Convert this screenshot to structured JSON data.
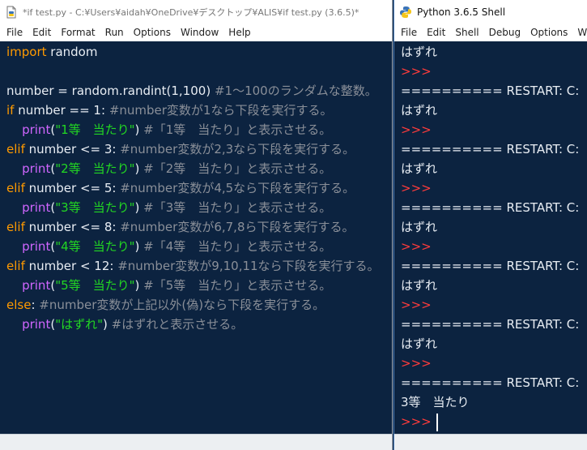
{
  "editor": {
    "title": "*if test.py - C:¥Users¥aidah¥OneDrive¥デスクトップ¥ALIS¥if test.py (3.6.5)*",
    "menu": [
      "File",
      "Edit",
      "Format",
      "Run",
      "Options",
      "Window",
      "Help"
    ],
    "code": [
      [
        {
          "t": "kw",
          "v": "import"
        },
        {
          "t": "tx",
          "v": " random"
        }
      ],
      [],
      [
        {
          "t": "tx",
          "v": "number = random.randint(1,100) "
        },
        {
          "t": "cm",
          "v": "#1～100のランダムな整数。"
        }
      ],
      [
        {
          "t": "kw",
          "v": "if"
        },
        {
          "t": "tx",
          "v": " number == 1: "
        },
        {
          "t": "cm",
          "v": "#number変数が1なら下段を実行する。"
        }
      ],
      [
        {
          "t": "tx",
          "v": "    "
        },
        {
          "t": "bi",
          "v": "print"
        },
        {
          "t": "tx",
          "v": "("
        },
        {
          "t": "st",
          "v": "\"1等　当たり\""
        },
        {
          "t": "tx",
          "v": ") "
        },
        {
          "t": "cm",
          "v": "#「1等　当たり」と表示させる。"
        }
      ],
      [
        {
          "t": "kw",
          "v": "elif"
        },
        {
          "t": "tx",
          "v": " number <= 3: "
        },
        {
          "t": "cm",
          "v": "#number変数が2,3なら下段を実行する。"
        }
      ],
      [
        {
          "t": "tx",
          "v": "    "
        },
        {
          "t": "bi",
          "v": "print"
        },
        {
          "t": "tx",
          "v": "("
        },
        {
          "t": "st",
          "v": "\"2等　当たり\""
        },
        {
          "t": "tx",
          "v": ") "
        },
        {
          "t": "cm",
          "v": "#「2等　当たり」と表示させる。"
        }
      ],
      [
        {
          "t": "kw",
          "v": "elif"
        },
        {
          "t": "tx",
          "v": " number <= 5: "
        },
        {
          "t": "cm",
          "v": "#number変数が4,5なら下段を実行する。"
        }
      ],
      [
        {
          "t": "tx",
          "v": "    "
        },
        {
          "t": "bi",
          "v": "print"
        },
        {
          "t": "tx",
          "v": "("
        },
        {
          "t": "st",
          "v": "\"3等　当たり\""
        },
        {
          "t": "tx",
          "v": ") "
        },
        {
          "t": "cm",
          "v": "#「3等　当たり」と表示させる。"
        }
      ],
      [
        {
          "t": "kw",
          "v": "elif"
        },
        {
          "t": "tx",
          "v": " number <= 8: "
        },
        {
          "t": "cm",
          "v": "#number変数が6,7,8ら下段を実行する。"
        }
      ],
      [
        {
          "t": "tx",
          "v": "    "
        },
        {
          "t": "bi",
          "v": "print"
        },
        {
          "t": "tx",
          "v": "("
        },
        {
          "t": "st",
          "v": "\"4等　当たり\""
        },
        {
          "t": "tx",
          "v": ") "
        },
        {
          "t": "cm",
          "v": "#「4等　当たり」と表示させる。"
        }
      ],
      [
        {
          "t": "kw",
          "v": "elif"
        },
        {
          "t": "tx",
          "v": " number < 12: "
        },
        {
          "t": "cm",
          "v": "#number変数が9,10,11なら下段を実行する。"
        }
      ],
      [
        {
          "t": "tx",
          "v": "    "
        },
        {
          "t": "bi",
          "v": "print"
        },
        {
          "t": "tx",
          "v": "("
        },
        {
          "t": "st",
          "v": "\"5等　当たり\""
        },
        {
          "t": "tx",
          "v": ") "
        },
        {
          "t": "cm",
          "v": "#「5等　当たり」と表示させる。"
        }
      ],
      [
        {
          "t": "kw",
          "v": "else"
        },
        {
          "t": "tx",
          "v": ": "
        },
        {
          "t": "cm",
          "v": "#number変数が上記以外(偽)なら下段を実行する。"
        }
      ],
      [
        {
          "t": "tx",
          "v": "    "
        },
        {
          "t": "bi",
          "v": "print"
        },
        {
          "t": "tx",
          "v": "("
        },
        {
          "t": "st",
          "v": "\"はずれ\""
        },
        {
          "t": "tx",
          "v": ") "
        },
        {
          "t": "cm",
          "v": "#はずれと表示させる。"
        }
      ]
    ]
  },
  "shell": {
    "title": "Python 3.6.5 Shell",
    "menu": [
      "File",
      "Edit",
      "Shell",
      "Debug",
      "Options",
      "Window"
    ],
    "lines": [
      {
        "t": "out",
        "v": "はずれ"
      },
      {
        "t": "pr",
        "v": ">>>"
      },
      {
        "t": "out",
        "v": "========== RESTART: C:"
      },
      {
        "t": "out",
        "v": "はずれ"
      },
      {
        "t": "pr",
        "v": ">>>"
      },
      {
        "t": "out",
        "v": "========== RESTART: C:"
      },
      {
        "t": "out",
        "v": "はずれ"
      },
      {
        "t": "pr",
        "v": ">>>"
      },
      {
        "t": "out",
        "v": "========== RESTART: C:"
      },
      {
        "t": "out",
        "v": "はずれ"
      },
      {
        "t": "pr",
        "v": ">>>"
      },
      {
        "t": "out",
        "v": "========== RESTART: C:"
      },
      {
        "t": "out",
        "v": "はずれ"
      },
      {
        "t": "pr",
        "v": ">>>"
      },
      {
        "t": "out",
        "v": "========== RESTART: C:"
      },
      {
        "t": "out",
        "v": "はずれ"
      },
      {
        "t": "pr",
        "v": ">>>"
      },
      {
        "t": "out",
        "v": "========== RESTART: C:"
      },
      {
        "t": "out",
        "v": "3等　当たり"
      },
      {
        "t": "pr",
        "v": ">>> "
      }
    ]
  },
  "colors": {
    "background": "#0c2340",
    "keyword": "#ff9a00",
    "builtin": "#d066ff",
    "string": "#22d822",
    "comment": "#8a8f98",
    "prompt": "#ff3b3b"
  },
  "icons": {
    "editor": "python-file-icon",
    "shell": "python-shell-icon"
  }
}
